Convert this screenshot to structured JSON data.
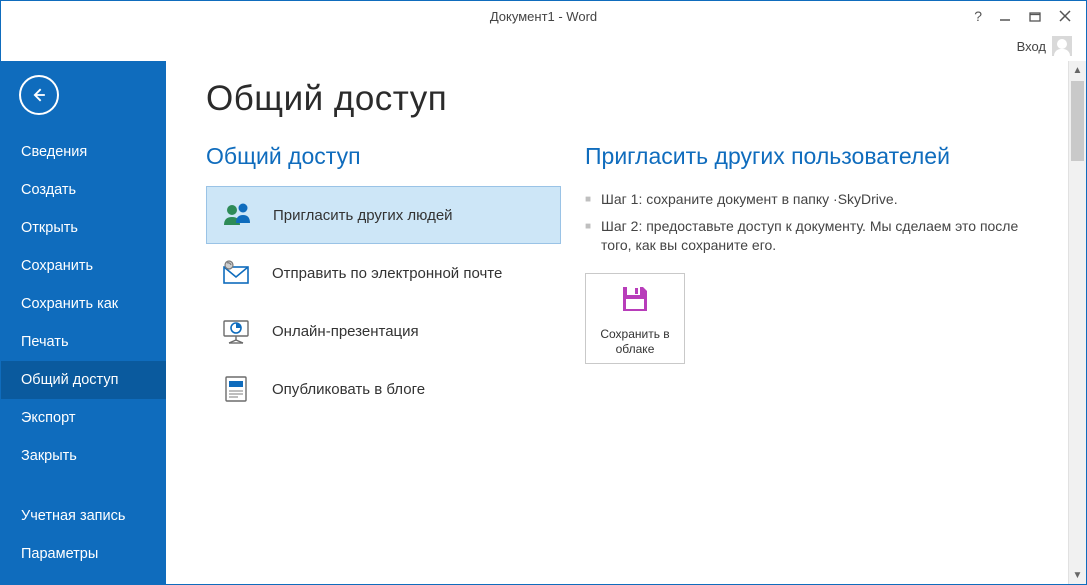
{
  "window": {
    "title": "Документ1 - Word",
    "help_tooltip": "?",
    "signin": "Вход"
  },
  "sidebar": {
    "items": [
      {
        "label": "Сведения"
      },
      {
        "label": "Создать"
      },
      {
        "label": "Открыть"
      },
      {
        "label": "Сохранить"
      },
      {
        "label": "Сохранить как"
      },
      {
        "label": "Печать"
      },
      {
        "label": "Общий доступ"
      },
      {
        "label": "Экспорт"
      },
      {
        "label": "Закрыть"
      }
    ],
    "footer_items": [
      {
        "label": "Учетная запись"
      },
      {
        "label": "Параметры"
      }
    ],
    "active_index": 6
  },
  "page": {
    "title": "Общий доступ",
    "share_heading": "Общий доступ",
    "options": [
      {
        "label": "Пригласить других людей",
        "icon": "people-icon"
      },
      {
        "label": "Отправить по электронной почте",
        "icon": "email-icon"
      },
      {
        "label": "Онлайн-презентация",
        "icon": "presentation-icon"
      },
      {
        "label": "Опубликовать в блоге",
        "icon": "blog-icon"
      }
    ],
    "invite_heading": "Пригласить других пользователей",
    "steps": [
      "Шаг 1: сохраните документ в папку ·SkyDrive.",
      "Шаг 2: предоставьте доступ к документу. Мы сделаем это после того, как вы сохраните его."
    ],
    "cloud_button": "Сохранить в облаке"
  },
  "colors": {
    "accent": "#0f6cbd",
    "sidebar_active": "#0a5a9e",
    "option_selected_bg": "#cde6f7",
    "save_icon": "#b83dba"
  }
}
